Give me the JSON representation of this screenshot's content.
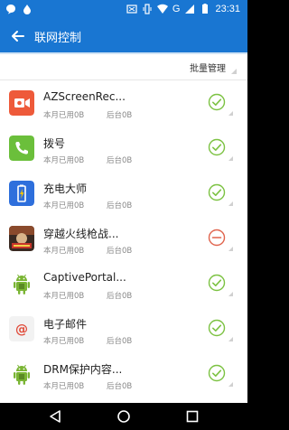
{
  "statusbar": {
    "time": "23:31",
    "network": "G"
  },
  "appbar": {
    "title": "联网控制"
  },
  "header": {
    "batch_label": "批量管理"
  },
  "colors": {
    "accent": "#1976d2",
    "allowed": "#7cc242",
    "blocked": "#e0634c"
  },
  "apps": [
    {
      "name": "AZScreenRec...",
      "month": "本月已用0B",
      "background": "后台0B",
      "status": "allowed",
      "icon": "screen-recorder-icon"
    },
    {
      "name": "拨号",
      "month": "本月已用0B",
      "background": "后台0B",
      "status": "allowed",
      "icon": "phone-icon"
    },
    {
      "name": "充电大师",
      "month": "本月已用0B",
      "background": "后台0B",
      "status": "allowed",
      "icon": "battery-icon"
    },
    {
      "name": "穿越火线枪战...",
      "month": "本月已用0B",
      "background": "后台0B",
      "status": "blocked",
      "icon": "game-icon"
    },
    {
      "name": "CaptivePortal...",
      "month": "本月已用0B",
      "background": "后台0B",
      "status": "allowed",
      "icon": "android-icon"
    },
    {
      "name": "电子邮件",
      "month": "本月已用0B",
      "background": "后台0B",
      "status": "allowed",
      "icon": "email-icon"
    },
    {
      "name": "DRM保护内容...",
      "month": "本月已用0B",
      "background": "后台0B",
      "status": "allowed",
      "icon": "android-icon"
    }
  ]
}
